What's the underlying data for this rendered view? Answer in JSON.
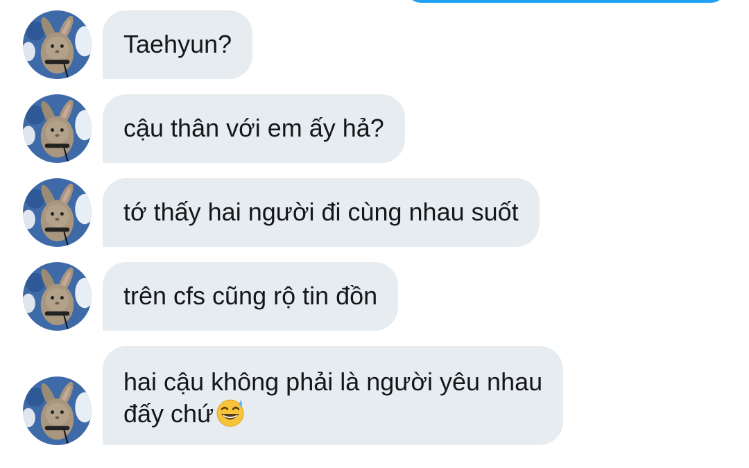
{
  "conversation": {
    "sender_avatar_icon": "rabbit-avatar-icon",
    "bubble_color": "#e6ecf0",
    "sent_bubble_color": "#1da1f2",
    "messages": [
      {
        "text": "Taehyun?"
      },
      {
        "text": "cậu thân với em ấy hả?"
      },
      {
        "text": "tớ thấy hai người đi cùng nhau suốt"
      },
      {
        "text": "trên cfs cũng rộ tin đồn"
      },
      {
        "line1": "hai cậu không phải là người yêu nhau",
        "line2": "đấy chứ",
        "emoji": "grinning-face-with-sweat-emoji"
      }
    ]
  }
}
